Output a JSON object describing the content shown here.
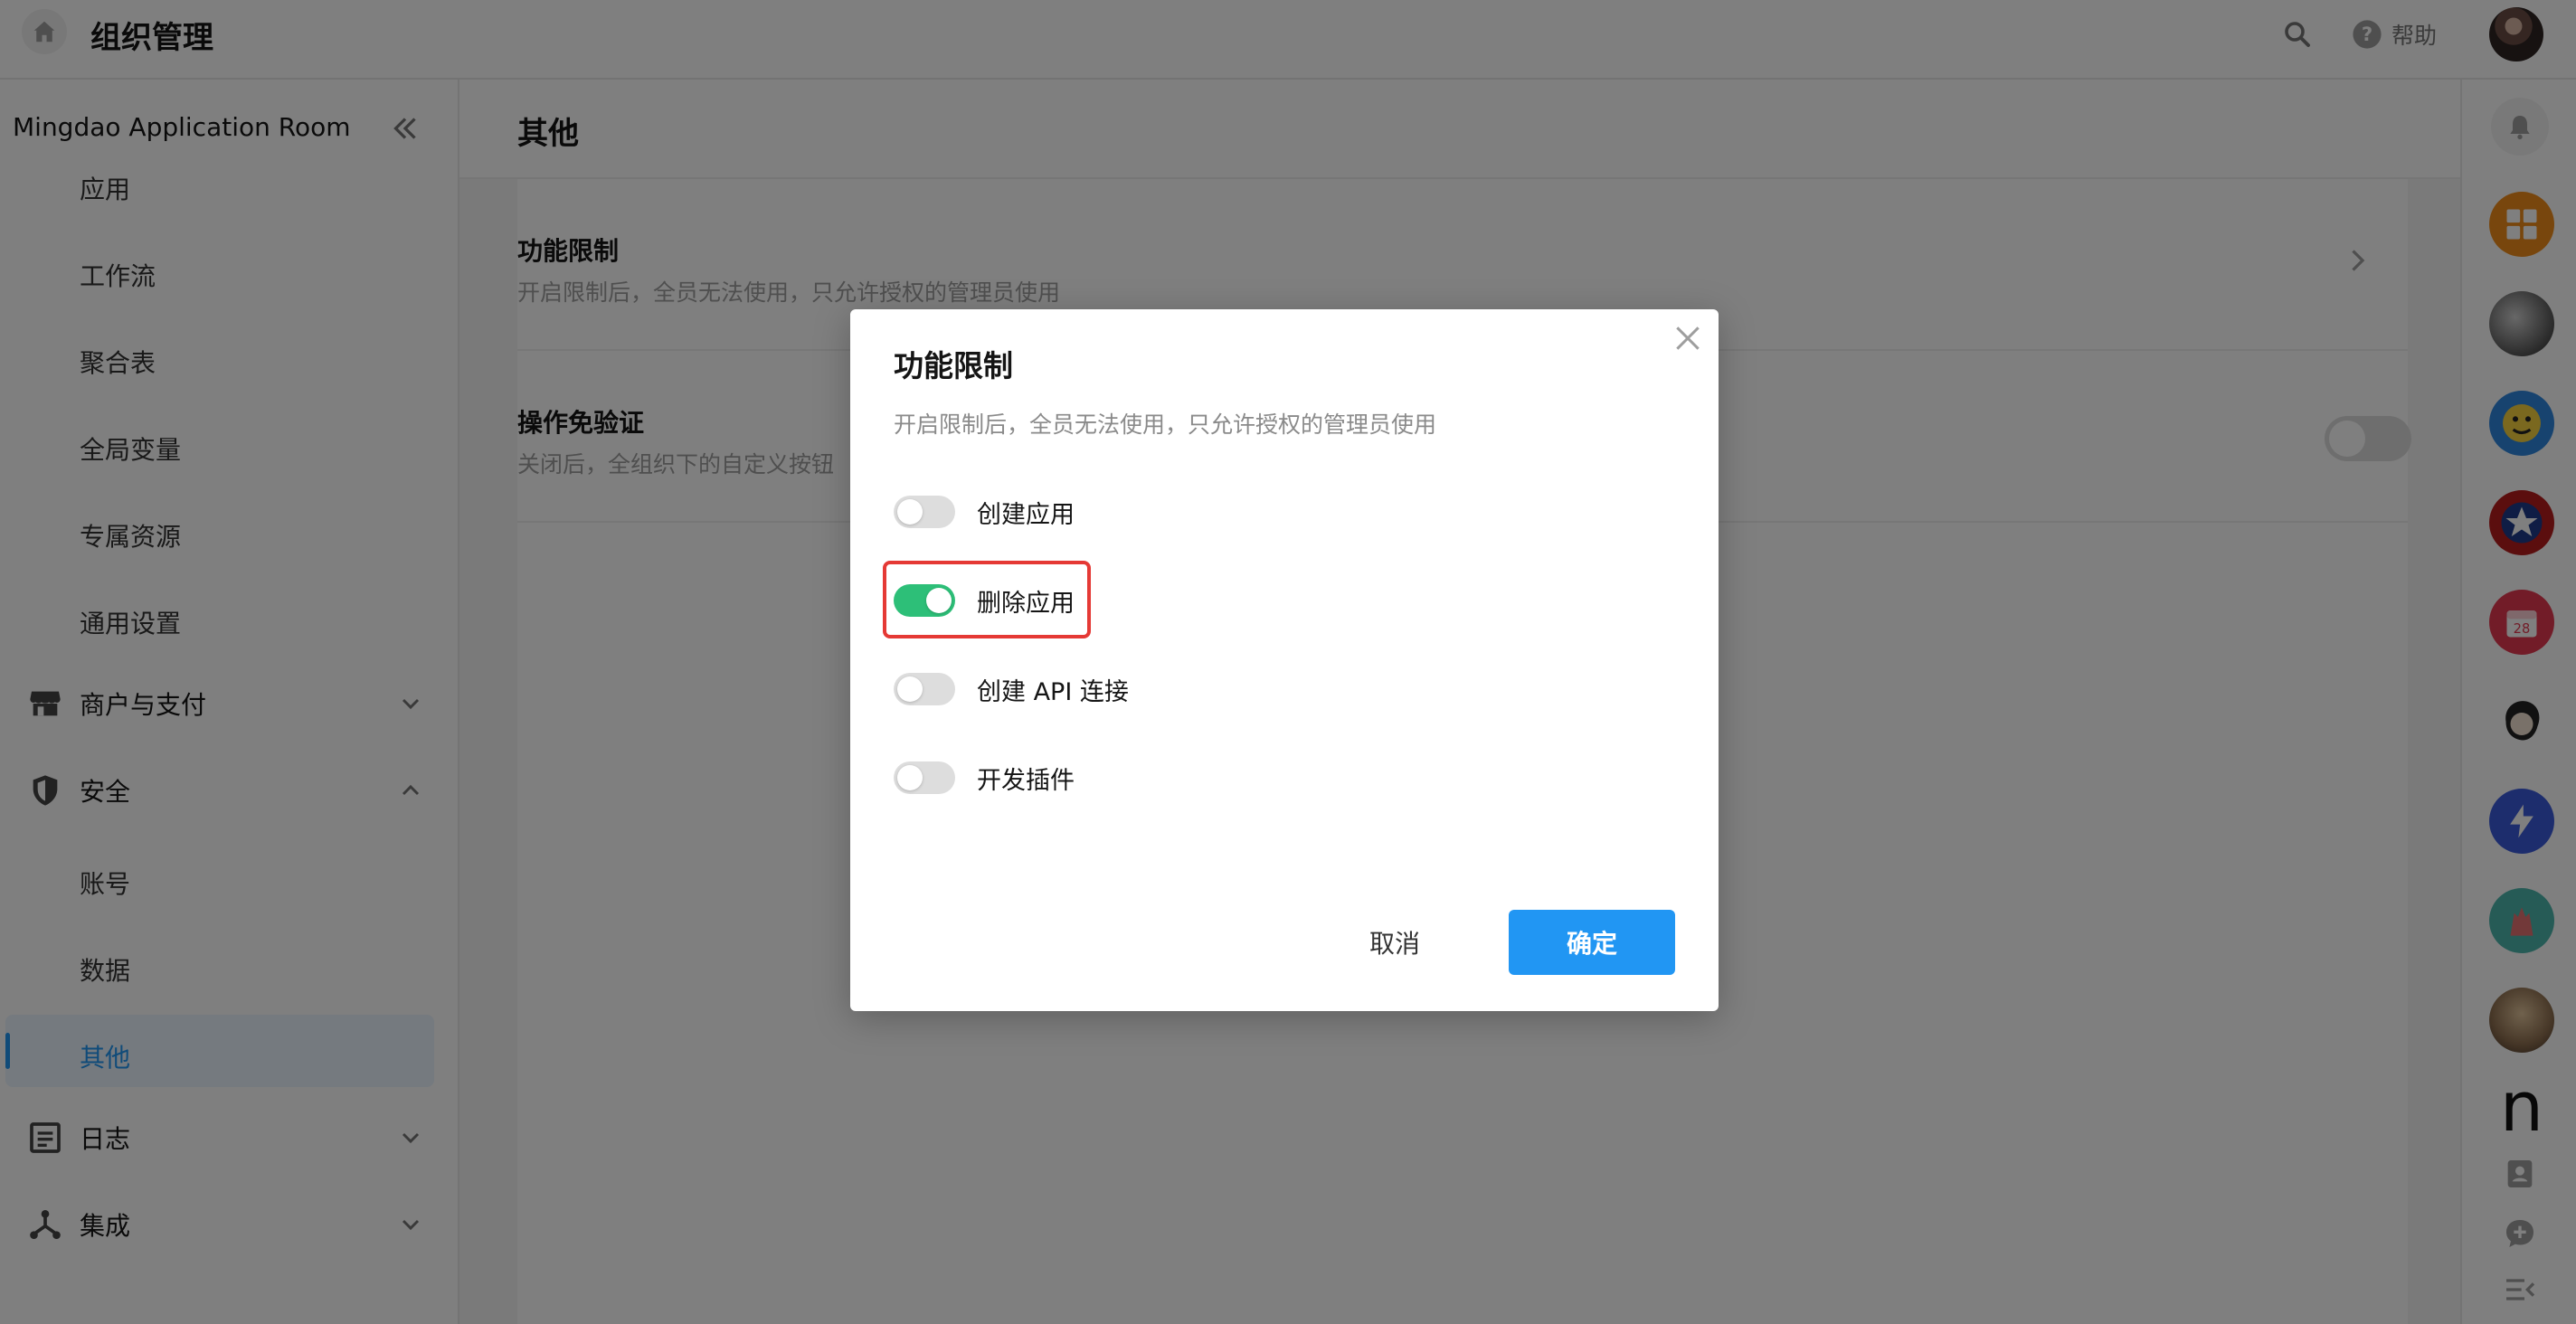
{
  "header": {
    "title": "组织管理",
    "help_label": "帮助",
    "icons": {
      "home": "home-icon",
      "search": "search-icon",
      "help": "help-circle-icon",
      "avatar": "user-avatar"
    }
  },
  "sidebar": {
    "org_name": "Mingdao Application Room",
    "items": [
      {
        "label": "应用",
        "type": "sub"
      },
      {
        "label": "工作流",
        "type": "sub"
      },
      {
        "label": "聚合表",
        "type": "sub"
      },
      {
        "label": "全局变量",
        "type": "sub"
      },
      {
        "label": "专属资源",
        "type": "sub"
      },
      {
        "label": "通用设置",
        "type": "sub"
      }
    ],
    "groups": [
      {
        "label": "商户与支付",
        "icon": "store-icon",
        "expanded": false
      },
      {
        "label": "安全",
        "icon": "shield-icon",
        "expanded": true
      },
      {
        "label": "日志",
        "icon": "log-icon",
        "expanded": false
      },
      {
        "label": "集成",
        "icon": "integration-icon",
        "expanded": false
      }
    ],
    "security_items": [
      {
        "label": "账号"
      },
      {
        "label": "数据"
      },
      {
        "label": "其他",
        "active": true
      }
    ],
    "accent_color": "#2196f3"
  },
  "main": {
    "title": "其他",
    "rows": [
      {
        "title": "功能限制",
        "desc": "开启限制后，全员无法使用，只允许授权的管理员使用"
      },
      {
        "title": "操作免验证",
        "desc": "关闭后，全组织下的自定义按钮"
      }
    ]
  },
  "dialog": {
    "title": "功能限制",
    "desc": "开启限制后，全员无法使用，只允许授权的管理员使用",
    "options": [
      {
        "label": "创建应用",
        "enabled": false
      },
      {
        "label": "删除应用",
        "enabled": true,
        "highlighted": true
      },
      {
        "label": "创建 API 连接",
        "enabled": false
      },
      {
        "label": "开发插件",
        "enabled": false
      }
    ],
    "cancel_label": "取消",
    "ok_label": "确定",
    "toggle_on_color": "#2dbf78",
    "highlight_color": "#e53935"
  },
  "rail": {
    "apps": [
      "grid-app-icon",
      "apple-app-icon",
      "character-app-icon",
      "shield-star-app-icon",
      "calendar-app-icon",
      "face-app-icon",
      "lightning-app-icon",
      "hands-app-icon",
      "portrait-app-icon",
      "n-app-icon"
    ],
    "calendar_day": "28",
    "n_glyph": "n",
    "tools": [
      "contacts-icon",
      "chat-add-icon",
      "menu-collapse-icon"
    ]
  }
}
